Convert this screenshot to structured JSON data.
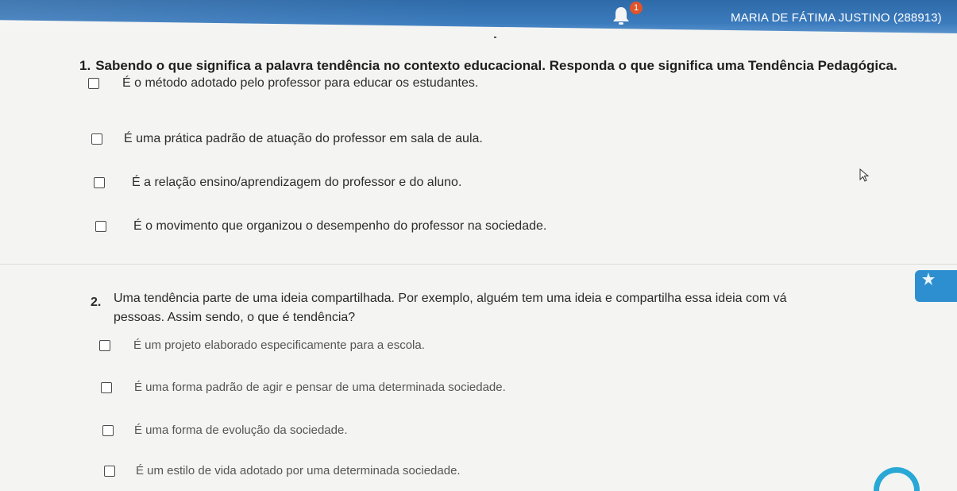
{
  "header": {
    "user_name": "MARIA DE FÁTIMA JUSTINO (288913)",
    "notification_count": "1",
    "bell_icon": "bell-icon"
  },
  "question1": {
    "number": "1.",
    "text": "Sabendo o que significa a palavra tendência no contexto educacional. Responda o que significa uma Tendência Pedagógica.",
    "options": [
      "É o método adotado pelo professor para educar os estudantes.",
      "É  uma prática padrão de atuação do professor em sala de aula.",
      "É a relação ensino/aprendizagem do professor e do aluno.",
      "É o movimento que organizou o desempenho do professor na sociedade."
    ]
  },
  "question2": {
    "number": "2.",
    "text_line1": "Uma tendência parte de uma ideia compartilhada. Por exemplo, alguém tem uma ideia e compartilha essa ideia com vá",
    "text_line2": "pessoas. Assim sendo, o que é tendência?",
    "options": [
      "É um projeto elaborado especificamente para a escola.",
      "É uma forma padrão de agir e pensar de uma determinada sociedade.",
      "É uma forma de evolução da sociedade.",
      "É um estilo de vida adotado por uma determinada sociedade."
    ]
  },
  "colors": {
    "header_blue": "#3b7bbd",
    "badge_orange": "#e0542c",
    "rating_blue": "#2e8fd0",
    "arc_cyan": "#29a8d6"
  }
}
